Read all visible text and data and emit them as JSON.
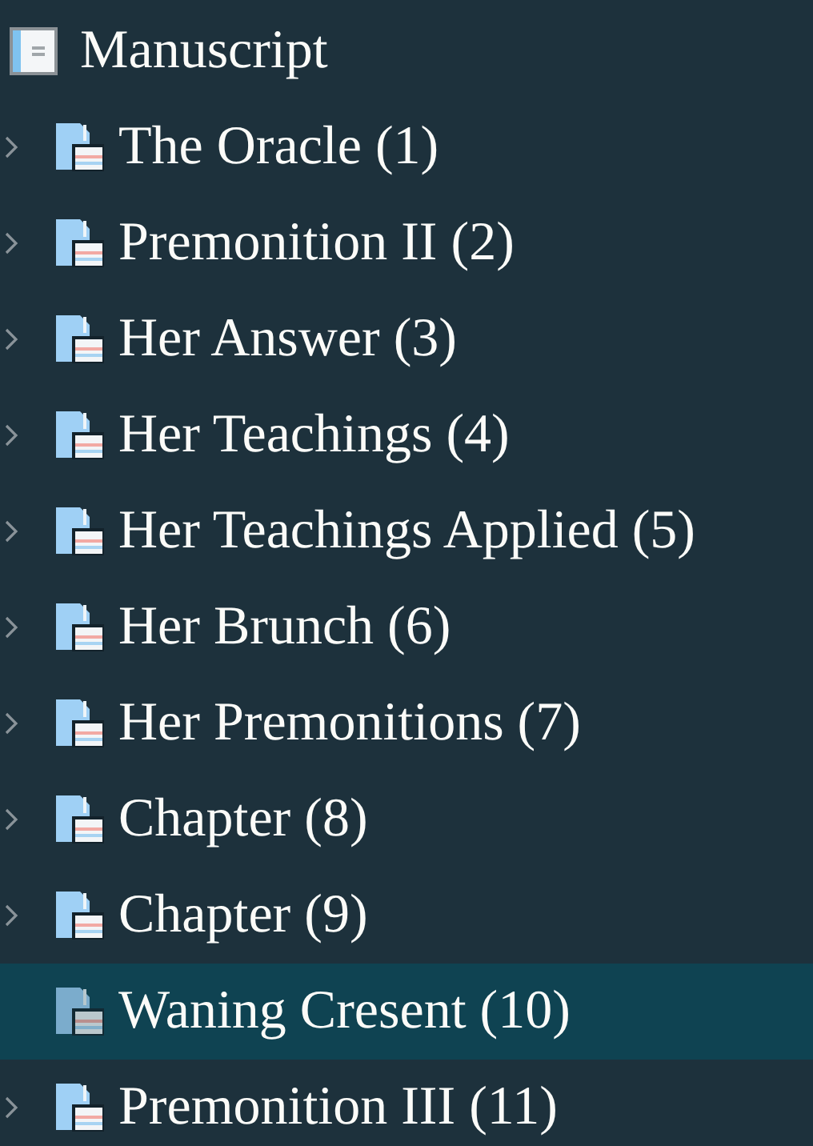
{
  "root": {
    "label": "Manuscript"
  },
  "items": [
    {
      "label": "The Oracle (1)",
      "collapsible": true,
      "selected": false
    },
    {
      "label": "Premonition II (2)",
      "collapsible": true,
      "selected": false
    },
    {
      "label": "Her Answer (3)",
      "collapsible": true,
      "selected": false
    },
    {
      "label": "Her Teachings (4)",
      "collapsible": true,
      "selected": false
    },
    {
      "label": "Her Teachings Applied (5)",
      "collapsible": true,
      "selected": false
    },
    {
      "label": "Her Brunch (6)",
      "collapsible": true,
      "selected": false
    },
    {
      "label": "Her Premonitions (7)",
      "collapsible": true,
      "selected": false
    },
    {
      "label": "Chapter (8)",
      "collapsible": true,
      "selected": false
    },
    {
      "label": "Chapter (9)",
      "collapsible": true,
      "selected": false
    },
    {
      "label": "Waning Cresent (10)",
      "collapsible": false,
      "selected": true
    },
    {
      "label": "Premonition III (11)",
      "collapsible": true,
      "selected": false
    }
  ]
}
